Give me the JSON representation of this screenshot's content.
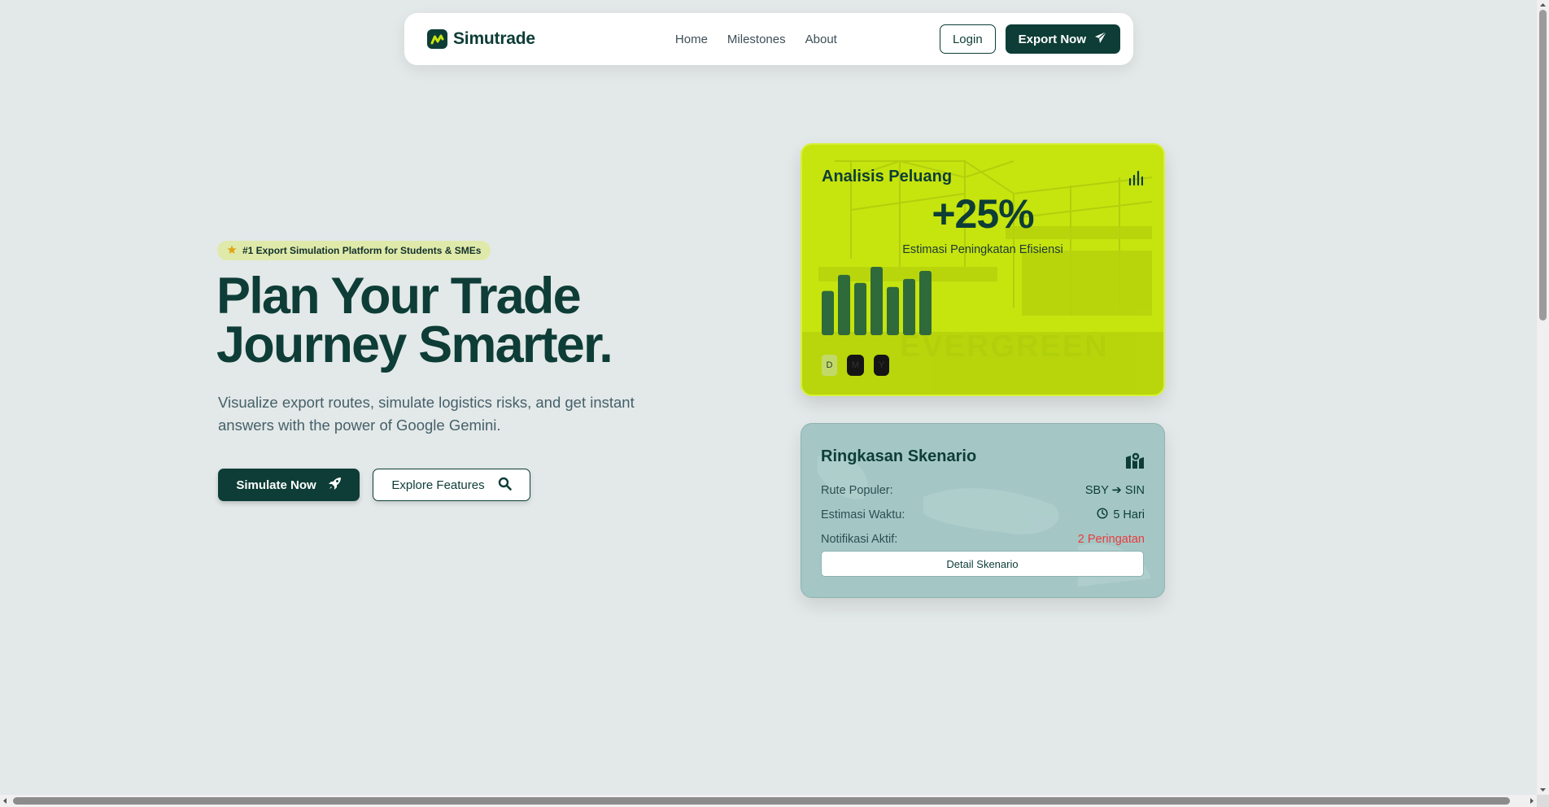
{
  "nav": {
    "brand": "Simutrade",
    "links": [
      "Home",
      "Milestones",
      "About"
    ],
    "login": "Login",
    "export": "Export Now"
  },
  "hero": {
    "badge": "#1 Export Simulation Platform for Students & SMEs",
    "title_line1": "Plan Your Trade",
    "title_line2": "Journey Smarter.",
    "subtitle": "Visualize export routes, simulate logistics risks, and get instant answers with the power of Google Gemini.",
    "simulate_button": "Simulate Now",
    "explore_button": "Explore Features"
  },
  "analysis": {
    "title": "Analisis Peluang",
    "value": "+25%",
    "caption": "Estimasi Peningkatan Efisiensi",
    "background_text": "EVERGREEN",
    "bars": [
      55,
      75,
      65,
      85,
      60,
      70,
      80
    ],
    "period_tabs": [
      "D",
      "M",
      "Y"
    ]
  },
  "scenario": {
    "title": "Ringkasan Skenario",
    "rows": [
      {
        "label": "Rute Populer:",
        "value": "SBY ➔ SIN"
      },
      {
        "label": "Estimasi Waktu:",
        "value": "5 Hari"
      },
      {
        "label": "Notifikasi Aktif:",
        "value": "2 Peringatan"
      }
    ],
    "detail_button": "Detail Skenario"
  },
  "colors": {
    "primary": "#0d3d36",
    "accent_lime": "#c6e40e",
    "scenario_bg": "#a4c7c6",
    "warning": "#e83c3c",
    "page_bg": "#e3e8e8"
  },
  "icons": {
    "brand": "chart-logo-icon",
    "export": "paper-plane-icon",
    "badge": "star-icon",
    "simulate": "rocket-icon",
    "explore": "search-icon",
    "analysis": "bar-chart-icon",
    "scenario": "map-pin-icon",
    "time": "clock-icon"
  }
}
